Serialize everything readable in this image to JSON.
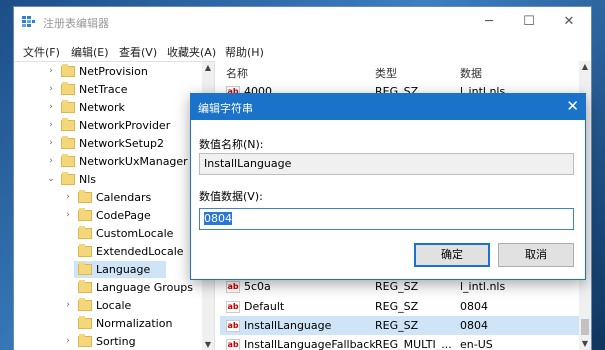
{
  "window": {
    "title": "注册表编辑器"
  },
  "menu": [
    "文件(F)",
    "编辑(E)",
    "查看(V)",
    "收藏夹(A)",
    "帮助(H)"
  ],
  "tree": [
    {
      "label": "NetProvision",
      "expanded": false
    },
    {
      "label": "NetTrace",
      "expanded": false
    },
    {
      "label": "Network",
      "expanded": false
    },
    {
      "label": "NetworkProvider",
      "expanded": false
    },
    {
      "label": "NetworkSetup2",
      "expanded": false
    },
    {
      "label": "NetworkUxManager",
      "expanded": false
    },
    {
      "label": "Nls",
      "expanded": true
    },
    {
      "label": "Calendars",
      "expanded": false
    },
    {
      "label": "CodePage",
      "expanded": false
    },
    {
      "label": "CustomLocale",
      "expanded": false
    },
    {
      "label": "ExtendedLocale",
      "expanded": false
    },
    {
      "label": "Language",
      "expanded": false,
      "selected": true
    },
    {
      "label": "Language Groups",
      "expanded": false
    },
    {
      "label": "Locale",
      "expanded": false
    },
    {
      "label": "Normalization",
      "expanded": false
    },
    {
      "label": "Sorting",
      "expanded": false
    }
  ],
  "list": {
    "headers": [
      "名称",
      "类型",
      "数据"
    ],
    "rows": [
      {
        "name": "4000",
        "type": "REG_SZ",
        "data": "l_intl.nls"
      },
      {
        "name": "5c0a",
        "type": "REG_SZ",
        "data": "l_intl.nls"
      },
      {
        "name": "Default",
        "type": "REG_SZ",
        "data": "0804"
      },
      {
        "name": "InstallLanguage",
        "type": "REG_SZ",
        "data": "0804",
        "selected": true
      },
      {
        "name": "InstallLanguageFallback",
        "type": "REG_MULTI_...",
        "data": "en-US"
      }
    ]
  },
  "dialog": {
    "title": "编辑字符串",
    "name_label": "数值名称(N):",
    "name_value": "InstallLanguage",
    "data_label": "数值数据(V):",
    "data_value": "0804",
    "ok_label": "确定",
    "cancel_label": "取消"
  },
  "colors": {
    "accent": "#1a73c8",
    "selection": "#cfe4f7"
  }
}
